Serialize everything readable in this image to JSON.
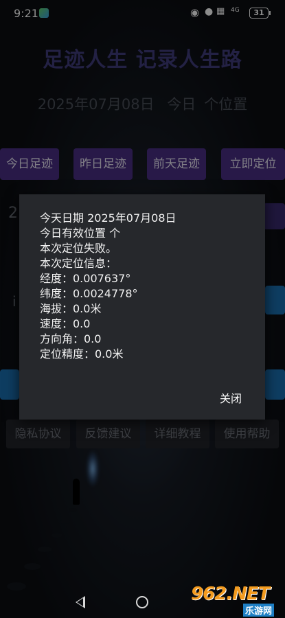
{
  "status_bar": {
    "time": "9:21",
    "network": "4G",
    "battery": "31"
  },
  "header": {
    "title": "足迹人生  记录人生路",
    "date": "2025年07月08日",
    "today": "今日",
    "positions": "个位置"
  },
  "buttons": {
    "today_track": "今日足迹",
    "yesterday_track": "昨日足迹",
    "day_before_track": "前天足迹",
    "locate_now": "立即定位"
  },
  "bottom_buttons": {
    "privacy": "隐私协议",
    "feedback": "反馈建议",
    "tutorial": "详细教程",
    "help": "使用帮助"
  },
  "dialog": {
    "lines": [
      "今天日期 2025年07月08日",
      "今日有效位置  个",
      "本次定位失败。",
      "本次定位信息：",
      "经度：0.007637°",
      "纬度：0.0024778°",
      "海拔：0.0米",
      "速度：0.0",
      "方向角：0.0",
      "定位精度：0.0米"
    ],
    "close": "关闭"
  },
  "watermark": {
    "logo": "962.NET",
    "sub": "乐游网"
  }
}
